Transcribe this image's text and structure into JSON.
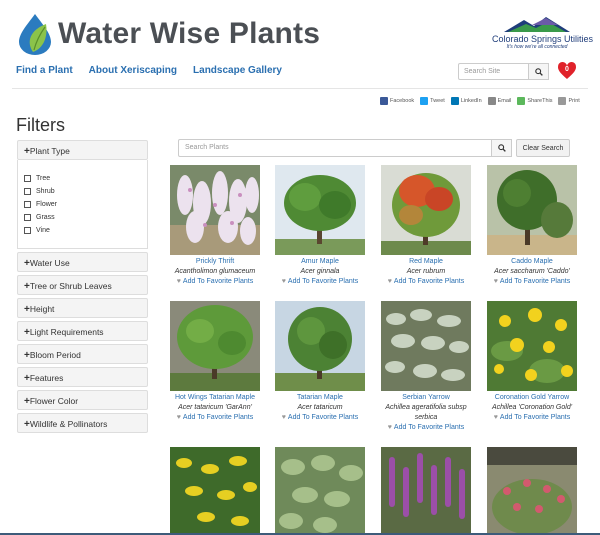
{
  "header": {
    "logo_text": "Water Wise Plants",
    "partner_name": "Colorado Springs Utilities",
    "partner_tagline": "It's how we're all connected"
  },
  "nav": [
    "Find a Plant",
    "About Xeriscaping",
    "Landscape Gallery"
  ],
  "site_search": {
    "placeholder": "Search Site"
  },
  "favorites": {
    "count": "0"
  },
  "share": [
    "Facebook",
    "Tweet",
    "LinkedIn",
    "Email",
    "ShareThis",
    "Print"
  ],
  "filters": {
    "title": "Filters",
    "plant_type": {
      "label": "Plant Type",
      "options": [
        "Tree",
        "Shrub",
        "Flower",
        "Grass",
        "Vine"
      ]
    },
    "groups": [
      "Water Use",
      "Tree or Shrub Leaves",
      "Height",
      "Light Requirements",
      "Bloom Period",
      "Features",
      "Flower Color",
      "Wildlife & Pollinators"
    ]
  },
  "plant_search": {
    "placeholder": "Search Plants",
    "clear_label": "Clear Search"
  },
  "fav_label": "Add To Favorite Plants",
  "plants": [
    {
      "common": "Prickly Thrift",
      "sci": "Acantholimon glumaceum"
    },
    {
      "common": "Amur Maple",
      "sci": "Acer ginnala"
    },
    {
      "common": "Red Maple",
      "sci": "Acer rubrum"
    },
    {
      "common": "Caddo Maple",
      "sci": "Acer saccharum 'Caddo'"
    },
    {
      "common": "Hot Wings Tatarian Maple",
      "sci": "Acer tataricum 'GarAnn'"
    },
    {
      "common": "Tatarian Maple",
      "sci": "Acer tataricum"
    },
    {
      "common": "Serbian Yarrow",
      "sci": "Achillea ageratifolia subsp",
      "sci2": "serbica"
    },
    {
      "common": "Coronation Gold Yarrow",
      "sci": "Achillea 'Coronation Gold'"
    }
  ]
}
